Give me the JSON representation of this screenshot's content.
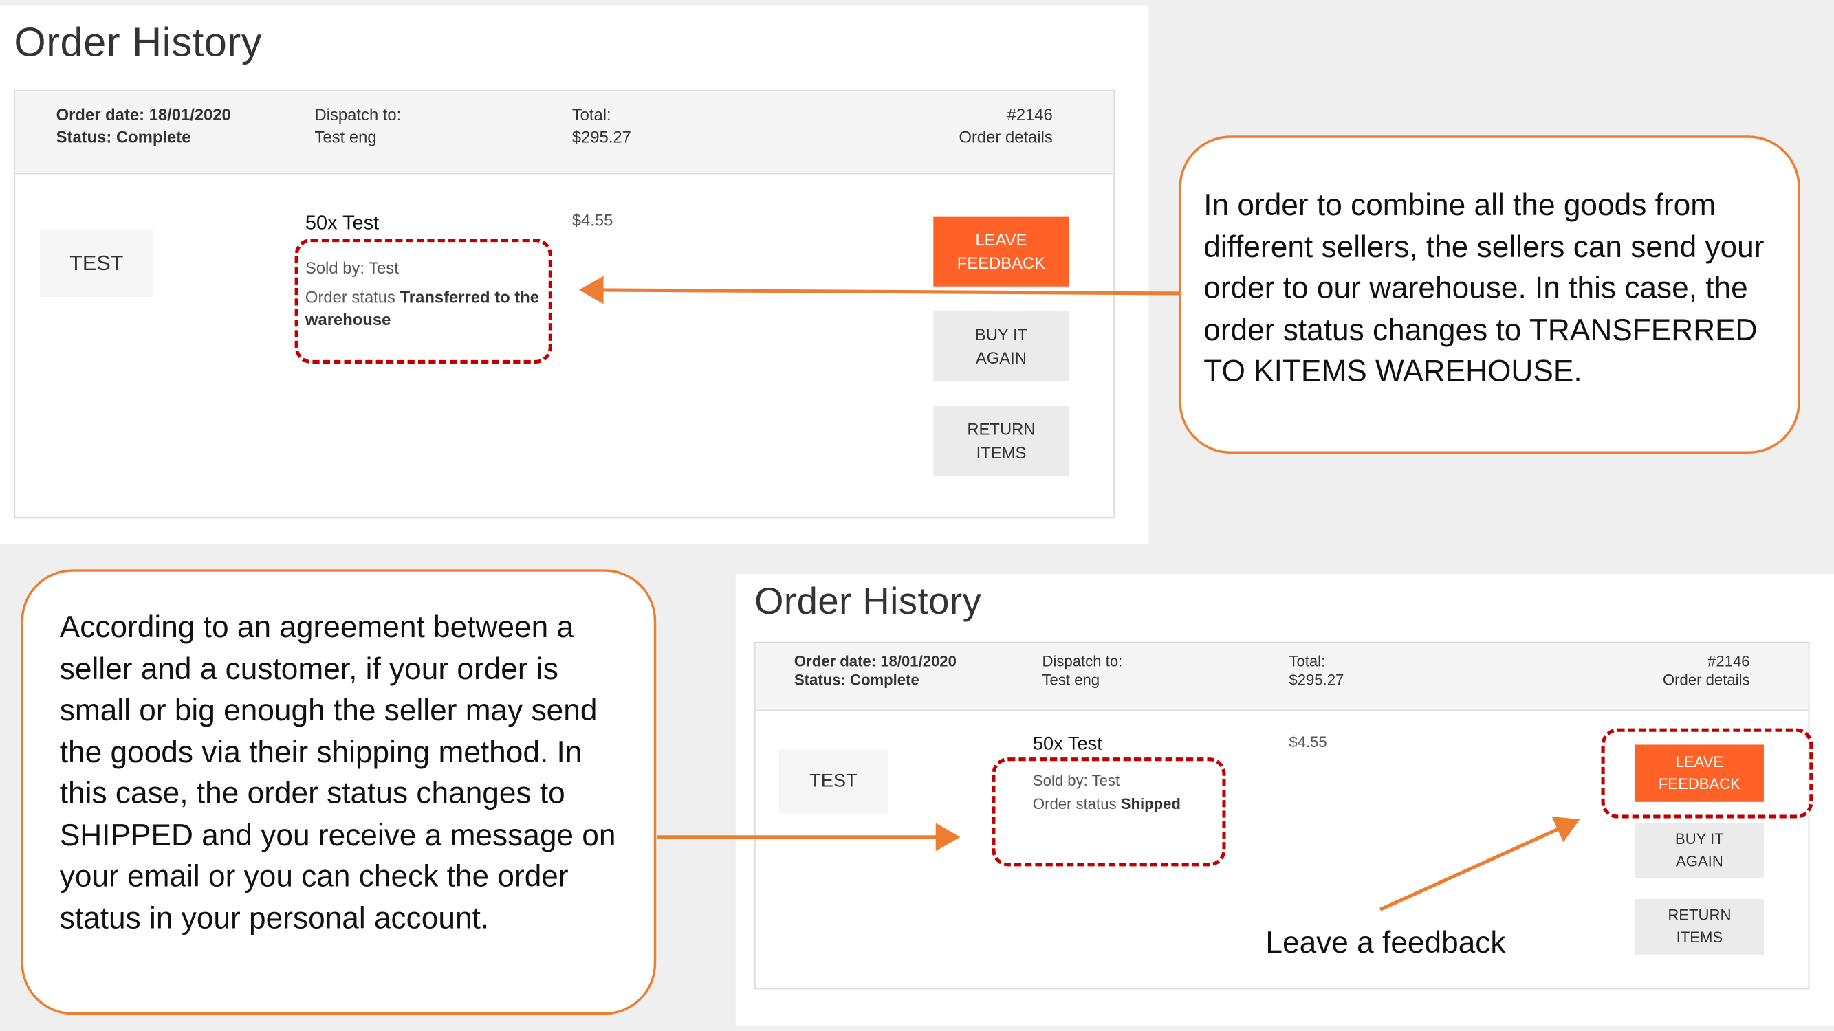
{
  "colors": {
    "accent": "#ff6127",
    "annotation_arrow": "#ed7d31",
    "highlight_dash": "#c00000"
  },
  "screen1": {
    "title": "Order History",
    "header": {
      "order_date": "Order date: 18/01/2020",
      "status": "Status: Complete",
      "dispatch_label": "Dispatch to:",
      "dispatch_value": "Test eng",
      "total_label": "Total:",
      "total_value": "$295.27",
      "order_number": "#2146",
      "order_details": "Order details"
    },
    "item": {
      "thumb": "TEST",
      "name": "50x Test",
      "sold_by": "Sold by: Test",
      "status_prefix": "Order status ",
      "status_value": "Transferred to the warehouse",
      "price": "$4.55"
    },
    "buttons": {
      "leave_feedback": "LEAVE FEEDBACK",
      "buy_again": "BUY IT AGAIN",
      "return_items": "RETURN ITEMS"
    }
  },
  "screen2": {
    "title": "Order History",
    "header": {
      "order_date": "Order date: 18/01/2020",
      "status": "Status: Complete",
      "dispatch_label": "Dispatch to:",
      "dispatch_value": "Test eng",
      "total_label": "Total:",
      "total_value": "$295.27",
      "order_number": "#2146",
      "order_details": "Order details"
    },
    "item": {
      "thumb": "TEST",
      "name": "50x Test",
      "sold_by": "Sold by: Test",
      "status_prefix": "Order status ",
      "status_value": "Shipped",
      "price": "$4.55"
    },
    "buttons": {
      "leave_feedback": "LEAVE FEEDBACK",
      "buy_again": "BUY IT AGAIN",
      "return_items": "RETURN ITEMS"
    }
  },
  "callouts": {
    "warehouse": "In order to combine all the goods from different sellers, the sellers can send your order to our warehouse. In this case, the order status changes to TRANSFERRED TO KITEMS WAREHOUSE.",
    "shipped": "According to an agreement between a seller and a customer, if your order is small or big enough the seller may send the goods via their shipping method. In this case, the order status changes to SHIPPED and you receive a message on your email or you can check the order status in your personal account.",
    "feedback": "Leave a feedback"
  }
}
